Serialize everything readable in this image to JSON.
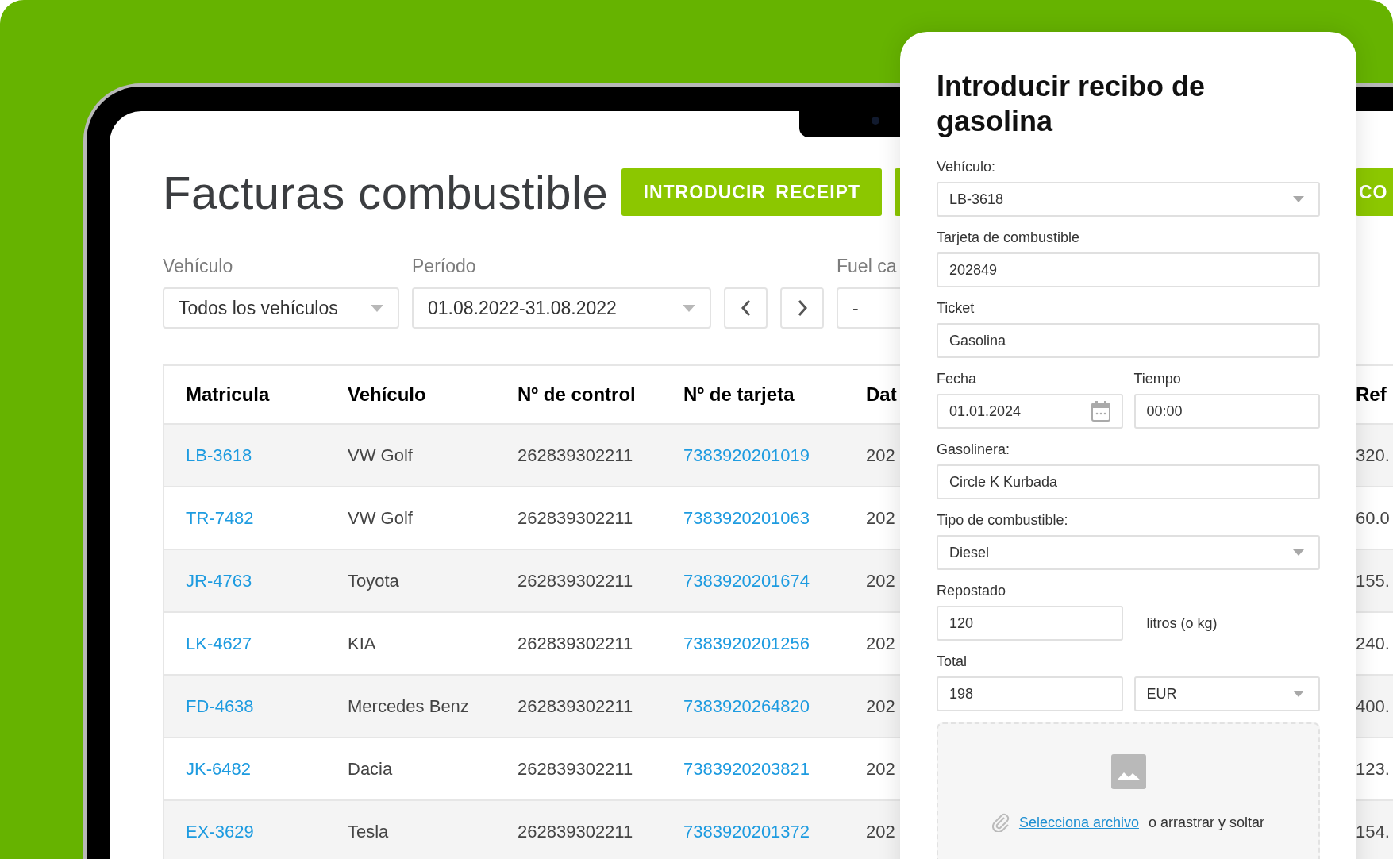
{
  "page": {
    "title": "Facturas combustible",
    "buttons": [
      {
        "label": "INTRODUCIR RECEIPT"
      },
      {
        "label": "CO"
      }
    ]
  },
  "filters": [
    {
      "kind": "select",
      "label": "Vehículo",
      "value": "Todos los vehículos"
    },
    {
      "kind": "select",
      "label": "Período",
      "value": "01.08.2022-31.08.2022"
    },
    {
      "kind": "nav"
    },
    {
      "kind": "select",
      "label": "Fuel ca",
      "value": "-"
    }
  ],
  "table": {
    "columns": [
      "Matricula",
      "Vehículo",
      "Nº de control",
      "Nº de tarjeta",
      "Dat",
      "Ref"
    ],
    "rows": [
      [
        "LB-3618",
        "VW Golf",
        "262839302211",
        "7383920201019",
        "202",
        "320."
      ],
      [
        "TR-7482",
        "VW Golf",
        "262839302211",
        "7383920201063",
        "202",
        "60.0"
      ],
      [
        "JR-4763",
        "Toyota",
        "262839302211",
        "7383920201674",
        "202",
        "155."
      ],
      [
        "LK-4627",
        "KIA",
        "262839302211",
        "7383920201256",
        "202",
        "240."
      ],
      [
        "FD-4638",
        "Mercedes Benz",
        "262839302211",
        "7383920264820",
        "202",
        "400."
      ],
      [
        "JK-6482",
        "Dacia",
        "262839302211",
        "7383920203821",
        "202",
        "123."
      ],
      [
        "EX-3629",
        "Tesla",
        "262839302211",
        "7383920201372",
        "202",
        "154."
      ]
    ]
  },
  "modal": {
    "title": "Introducir recibo de gasolina",
    "rows": [
      {
        "fields": [
          {
            "label": "Vehículo:",
            "value": "LB-3618",
            "kind": "select"
          }
        ]
      },
      {
        "fields": [
          {
            "label": "Tarjeta de combustible",
            "value": "202849",
            "kind": "text"
          }
        ]
      },
      {
        "fields": [
          {
            "label": "Ticket",
            "value": "Gasolina",
            "kind": "text"
          }
        ]
      },
      {
        "fields": [
          {
            "label": "Fecha",
            "value": "01.01.2024",
            "kind": "date"
          },
          {
            "label": "Tiempo",
            "value": "00:00",
            "kind": "text"
          }
        ]
      },
      {
        "fields": [
          {
            "label": "Gasolinera:",
            "value": "Circle K Kurbada",
            "kind": "text"
          }
        ]
      },
      {
        "fields": [
          {
            "label": "Tipo de combustible:",
            "value": "Diesel",
            "kind": "select"
          }
        ]
      },
      {
        "fields": [
          {
            "label": "Repostado",
            "value": "120",
            "kind": "text"
          }
        ],
        "unit": "litros (o kg)"
      },
      {
        "fields": [
          {
            "label": "Total",
            "value": "198",
            "kind": "text"
          },
          {
            "value": "EUR",
            "kind": "select"
          }
        ]
      }
    ],
    "dropzone": {
      "link": "Selecciona archivo",
      "text": "o arrastrar y soltar"
    }
  }
}
